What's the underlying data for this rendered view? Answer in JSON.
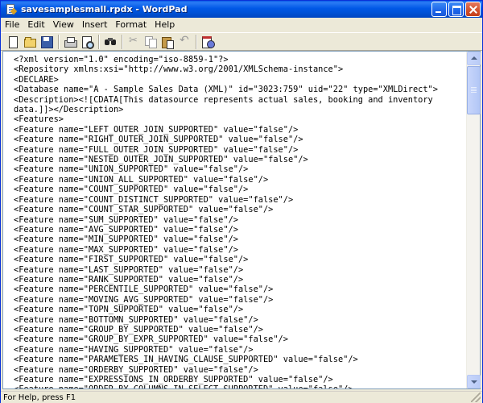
{
  "window": {
    "title": "savesamplesmall.rpdx - WordPad",
    "app_icon": "wordpad-icon",
    "controls": [
      "minimize",
      "maximize",
      "close"
    ]
  },
  "menubar": {
    "items": [
      "File",
      "Edit",
      "View",
      "Insert",
      "Format",
      "Help"
    ]
  },
  "toolbar": {
    "buttons": [
      {
        "name": "new-document",
        "icon": "new-document-icon",
        "enabled": true
      },
      {
        "name": "open",
        "icon": "folder-open-icon",
        "enabled": true
      },
      {
        "name": "save",
        "icon": "floppy-disk-icon",
        "enabled": true
      },
      {
        "name": "print",
        "icon": "printer-icon",
        "enabled": true
      },
      {
        "name": "print-preview",
        "icon": "print-preview-icon",
        "enabled": true
      },
      {
        "name": "find",
        "icon": "binoculars-icon",
        "enabled": true
      },
      {
        "name": "cut",
        "icon": "scissors-icon",
        "enabled": false
      },
      {
        "name": "copy",
        "icon": "copy-icon",
        "enabled": false
      },
      {
        "name": "paste",
        "icon": "clipboard-icon",
        "enabled": true
      },
      {
        "name": "undo",
        "icon": "undo-icon",
        "enabled": false
      },
      {
        "name": "date-time",
        "icon": "calendar-clock-icon",
        "enabled": true
      }
    ]
  },
  "document": {
    "lines": [
      "<?xml version=\"1.0\" encoding=\"iso-8859-1\"?>",
      "<Repository xmlns:xsi=\"http://www.w3.org/2001/XMLSchema-instance\">",
      "<DECLARE>",
      "<Database name=\"A - Sample Sales Data (XML)\" id=\"3023:759\" uid=\"22\" type=\"XMLDirect\">",
      "<Description><![CDATA[This datasource represents actual sales, booking and inventory",
      "data.]]></Description>",
      "<Features>",
      "<Feature name=\"LEFT_OUTER_JOIN_SUPPORTED\" value=\"false\"/>",
      "<Feature name=\"RIGHT_OUTER_JOIN_SUPPORTED\" value=\"false\"/>",
      "<Feature name=\"FULL_OUTER_JOIN_SUPPORTED\" value=\"false\"/>",
      "<Feature name=\"NESTED_OUTER_JOIN_SUPPORTED\" value=\"false\"/>",
      "<Feature name=\"UNION_SUPPORTED\" value=\"false\"/>",
      "<Feature name=\"UNION_ALL_SUPPORTED\" value=\"false\"/>",
      "<Feature name=\"COUNT_SUPPORTED\" value=\"false\"/>",
      "<Feature name=\"COUNT_DISTINCT_SUPPORTED\" value=\"false\"/>",
      "<Feature name=\"COUNT_STAR_SUPPORTED\" value=\"false\"/>",
      "<Feature name=\"SUM_SUPPORTED\" value=\"false\"/>",
      "<Feature name=\"AVG_SUPPORTED\" value=\"false\"/>",
      "<Feature name=\"MIN_SUPPORTED\" value=\"false\"/>",
      "<Feature name=\"MAX_SUPPORTED\" value=\"false\"/>",
      "<Feature name=\"FIRST_SUPPORTED\" value=\"false\"/>",
      "<Feature name=\"LAST_SUPPORTED\" value=\"false\"/>",
      "<Feature name=\"RANK_SUPPORTED\" value=\"false\"/>",
      "<Feature name=\"PERCENTILE_SUPPORTED\" value=\"false\"/>",
      "<Feature name=\"MOVING_AVG_SUPPORTED\" value=\"false\"/>",
      "<Feature name=\"TOPN_SUPPORTED\" value=\"false\"/>",
      "<Feature name=\"BOTTOMN_SUPPORTED\" value=\"false\"/>",
      "<Feature name=\"GROUP_BY_SUPPORTED\" value=\"false\"/>",
      "<Feature name=\"GROUP_BY_EXPR_SUPPORTED\" value=\"false\"/>",
      "<Feature name=\"HAVING_SUPPORTED\" value=\"false\"/>",
      "<Feature name=\"PARAMETERS_IN_HAVING_CLAUSE_SUPPORTED\" value=\"false\"/>",
      "<Feature name=\"ORDERBY_SUPPORTED\" value=\"false\"/>",
      "<Feature name=\"EXPRESSIONS_IN_ORDERBY_SUPPORTED\" value=\"false\"/>",
      "<Feature name=\"ORDER_BY_COLUMNS_IN_SELECT_SUPPORTED\" value=\"false\"/>"
    ]
  },
  "statusbar": {
    "text": "For Help, press F1"
  }
}
